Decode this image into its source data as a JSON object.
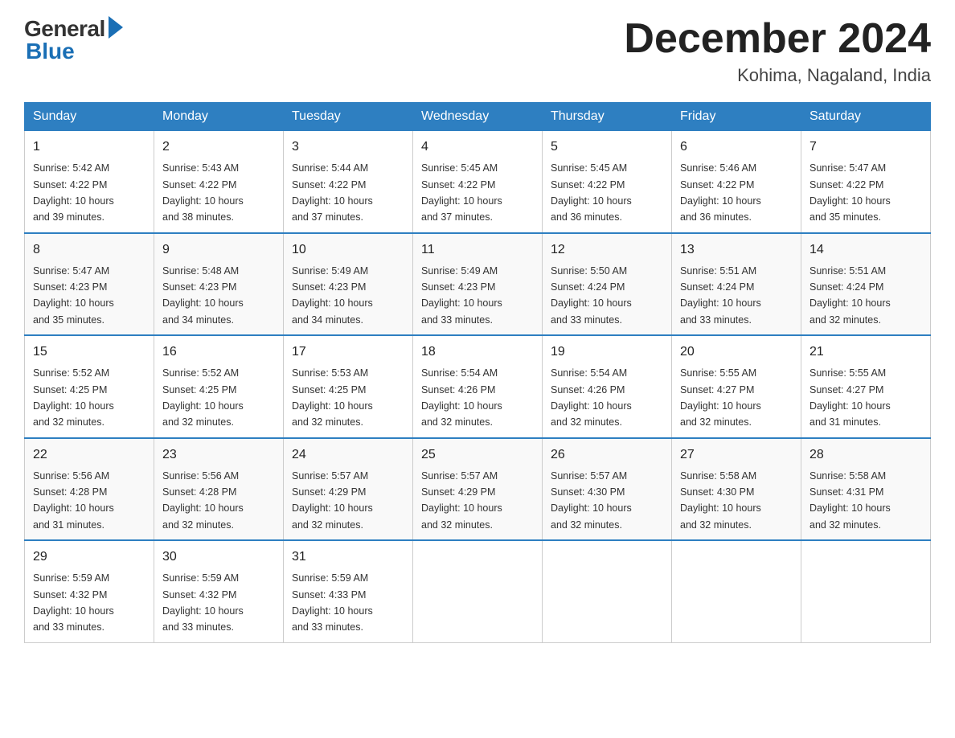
{
  "logo": {
    "general": "General",
    "blue": "Blue"
  },
  "title": "December 2024",
  "location": "Kohima, Nagaland, India",
  "days_of_week": [
    "Sunday",
    "Monday",
    "Tuesday",
    "Wednesday",
    "Thursday",
    "Friday",
    "Saturday"
  ],
  "weeks": [
    [
      {
        "day": "1",
        "sunrise": "5:42 AM",
        "sunset": "4:22 PM",
        "daylight": "10 hours and 39 minutes."
      },
      {
        "day": "2",
        "sunrise": "5:43 AM",
        "sunset": "4:22 PM",
        "daylight": "10 hours and 38 minutes."
      },
      {
        "day": "3",
        "sunrise": "5:44 AM",
        "sunset": "4:22 PM",
        "daylight": "10 hours and 37 minutes."
      },
      {
        "day": "4",
        "sunrise": "5:45 AM",
        "sunset": "4:22 PM",
        "daylight": "10 hours and 37 minutes."
      },
      {
        "day": "5",
        "sunrise": "5:45 AM",
        "sunset": "4:22 PM",
        "daylight": "10 hours and 36 minutes."
      },
      {
        "day": "6",
        "sunrise": "5:46 AM",
        "sunset": "4:22 PM",
        "daylight": "10 hours and 36 minutes."
      },
      {
        "day": "7",
        "sunrise": "5:47 AM",
        "sunset": "4:22 PM",
        "daylight": "10 hours and 35 minutes."
      }
    ],
    [
      {
        "day": "8",
        "sunrise": "5:47 AM",
        "sunset": "4:23 PM",
        "daylight": "10 hours and 35 minutes."
      },
      {
        "day": "9",
        "sunrise": "5:48 AM",
        "sunset": "4:23 PM",
        "daylight": "10 hours and 34 minutes."
      },
      {
        "day": "10",
        "sunrise": "5:49 AM",
        "sunset": "4:23 PM",
        "daylight": "10 hours and 34 minutes."
      },
      {
        "day": "11",
        "sunrise": "5:49 AM",
        "sunset": "4:23 PM",
        "daylight": "10 hours and 33 minutes."
      },
      {
        "day": "12",
        "sunrise": "5:50 AM",
        "sunset": "4:24 PM",
        "daylight": "10 hours and 33 minutes."
      },
      {
        "day": "13",
        "sunrise": "5:51 AM",
        "sunset": "4:24 PM",
        "daylight": "10 hours and 33 minutes."
      },
      {
        "day": "14",
        "sunrise": "5:51 AM",
        "sunset": "4:24 PM",
        "daylight": "10 hours and 32 minutes."
      }
    ],
    [
      {
        "day": "15",
        "sunrise": "5:52 AM",
        "sunset": "4:25 PM",
        "daylight": "10 hours and 32 minutes."
      },
      {
        "day": "16",
        "sunrise": "5:52 AM",
        "sunset": "4:25 PM",
        "daylight": "10 hours and 32 minutes."
      },
      {
        "day": "17",
        "sunrise": "5:53 AM",
        "sunset": "4:25 PM",
        "daylight": "10 hours and 32 minutes."
      },
      {
        "day": "18",
        "sunrise": "5:54 AM",
        "sunset": "4:26 PM",
        "daylight": "10 hours and 32 minutes."
      },
      {
        "day": "19",
        "sunrise": "5:54 AM",
        "sunset": "4:26 PM",
        "daylight": "10 hours and 32 minutes."
      },
      {
        "day": "20",
        "sunrise": "5:55 AM",
        "sunset": "4:27 PM",
        "daylight": "10 hours and 32 minutes."
      },
      {
        "day": "21",
        "sunrise": "5:55 AM",
        "sunset": "4:27 PM",
        "daylight": "10 hours and 31 minutes."
      }
    ],
    [
      {
        "day": "22",
        "sunrise": "5:56 AM",
        "sunset": "4:28 PM",
        "daylight": "10 hours and 31 minutes."
      },
      {
        "day": "23",
        "sunrise": "5:56 AM",
        "sunset": "4:28 PM",
        "daylight": "10 hours and 32 minutes."
      },
      {
        "day": "24",
        "sunrise": "5:57 AM",
        "sunset": "4:29 PM",
        "daylight": "10 hours and 32 minutes."
      },
      {
        "day": "25",
        "sunrise": "5:57 AM",
        "sunset": "4:29 PM",
        "daylight": "10 hours and 32 minutes."
      },
      {
        "day": "26",
        "sunrise": "5:57 AM",
        "sunset": "4:30 PM",
        "daylight": "10 hours and 32 minutes."
      },
      {
        "day": "27",
        "sunrise": "5:58 AM",
        "sunset": "4:30 PM",
        "daylight": "10 hours and 32 minutes."
      },
      {
        "day": "28",
        "sunrise": "5:58 AM",
        "sunset": "4:31 PM",
        "daylight": "10 hours and 32 minutes."
      }
    ],
    [
      {
        "day": "29",
        "sunrise": "5:59 AM",
        "sunset": "4:32 PM",
        "daylight": "10 hours and 33 minutes."
      },
      {
        "day": "30",
        "sunrise": "5:59 AM",
        "sunset": "4:32 PM",
        "daylight": "10 hours and 33 minutes."
      },
      {
        "day": "31",
        "sunrise": "5:59 AM",
        "sunset": "4:33 PM",
        "daylight": "10 hours and 33 minutes."
      },
      null,
      null,
      null,
      null
    ]
  ],
  "labels": {
    "sunrise": "Sunrise:",
    "sunset": "Sunset:",
    "daylight": "Daylight:"
  }
}
